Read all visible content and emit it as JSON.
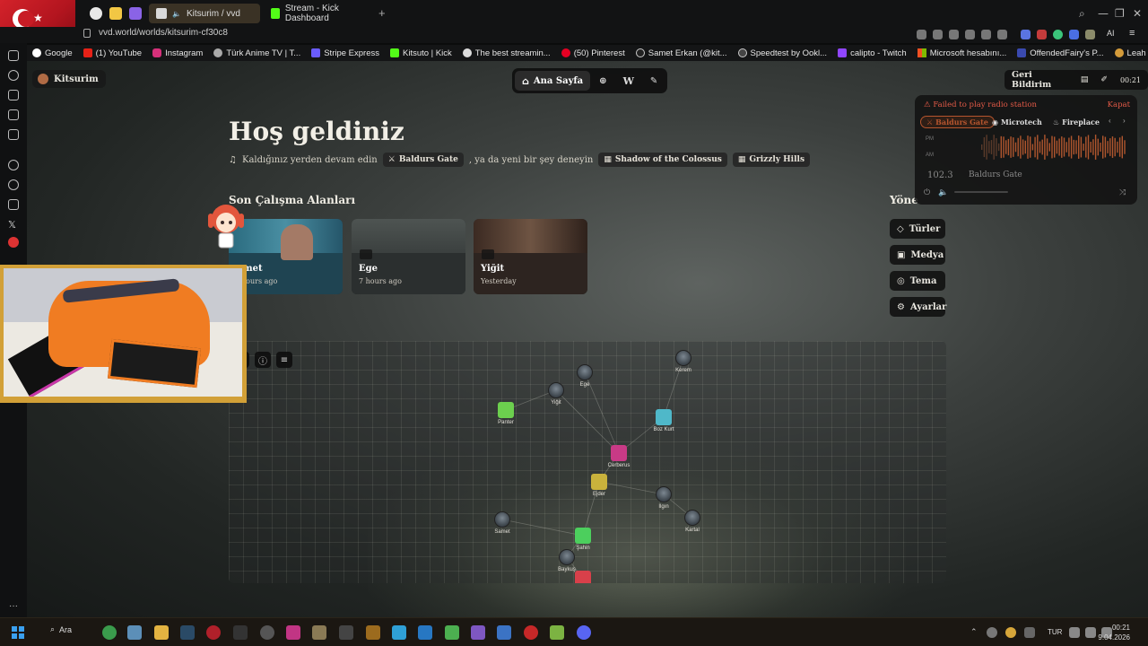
{
  "browser": {
    "tabs": [
      {
        "label": "Kitsurim / vvd",
        "active": true
      },
      {
        "label": "Stream - Kick Dashboard",
        "active": false
      }
    ],
    "new_tab": "+",
    "url": "vvd.world/worlds/kitsurim-cf30c8",
    "ai_label": "AI",
    "bookmarks": [
      "Google",
      "(1) YouTube",
      "Instagram",
      "Türk Anime TV | T...",
      "Stripe Express",
      "Kitsuto | Kick",
      "The best streamin...",
      "(50) Pinterest",
      "Samet Erkan (@kit...",
      "Speedtest by Ookl...",
      "calipto - Twitch",
      "Microsoft hesabını...",
      "OffendedFairy's P...",
      "Leah - Stardew Va..."
    ],
    "sidebar_label": "GX"
  },
  "app": {
    "workspace": "Kitsurim",
    "nav": {
      "home": "Ana Sayfa"
    },
    "feedback": "Geri Bildirim",
    "time_badge": "00:21"
  },
  "welcome": {
    "title": "Hoş geldiniz",
    "continue_text": "Kaldığınız yerden devam edin",
    "continue_chip": "Baldurs Gate",
    "or_text": ", ya da yeni bir şey deneyin",
    "suggestions": [
      "Shadow of the Colossus",
      "Grizzly Hills"
    ]
  },
  "recent": {
    "title": "Son Çalışma Alanları",
    "cards": [
      {
        "name": "Samet",
        "time": "2 hours ago",
        "visible_name": "met",
        "visible_time": "hours ago"
      },
      {
        "name": "Ege",
        "time": "7 hours ago"
      },
      {
        "name": "Yiğit",
        "time": "Yesterday"
      }
    ]
  },
  "quick": {
    "title": "Yöne",
    "items": [
      {
        "label": "Türler",
        "icon": "tag-icon"
      },
      {
        "label": "Medya",
        "icon": "image-icon"
      },
      {
        "label": "Tema",
        "icon": "palette-icon"
      },
      {
        "label": "Ayarlar",
        "icon": "gear-icon"
      }
    ]
  },
  "radio": {
    "error": "Failed to play radio station",
    "close": "Kapat",
    "stations": [
      "Baldurs Gate",
      "Microtech",
      "Fireplace"
    ],
    "frequency": "102.3",
    "station_name": "Baldurs Gate",
    "pm": "PM",
    "am": "AM"
  },
  "graph": {
    "nodes": [
      {
        "label": "Kerem",
        "kind": "avatar"
      },
      {
        "label": "Ege",
        "kind": "avatar"
      },
      {
        "label": "Yiğit",
        "kind": "avatar"
      },
      {
        "label": "Panter",
        "kind": "square",
        "color": "#6ccf4e"
      },
      {
        "label": "Boz Kurt",
        "kind": "square",
        "color": "#4fb8c9"
      },
      {
        "label": "Cerberus",
        "kind": "square",
        "color": "#c83a86"
      },
      {
        "label": "Ejder",
        "kind": "square",
        "color": "#c9b23c"
      },
      {
        "label": "Ilgın",
        "kind": "avatar"
      },
      {
        "label": "Kartal",
        "kind": "avatar"
      },
      {
        "label": "Samet",
        "kind": "avatar"
      },
      {
        "label": "Şahin",
        "kind": "square",
        "color": "#4ccf5d"
      },
      {
        "label": "Baykuş",
        "kind": "avatar"
      },
      {
        "label": "",
        "kind": "square",
        "color": "#d8404a"
      }
    ]
  },
  "taskbar": {
    "search": "Ara",
    "lang": "TUR",
    "time": "00:21",
    "date": "9.04.2026"
  },
  "help": "?"
}
